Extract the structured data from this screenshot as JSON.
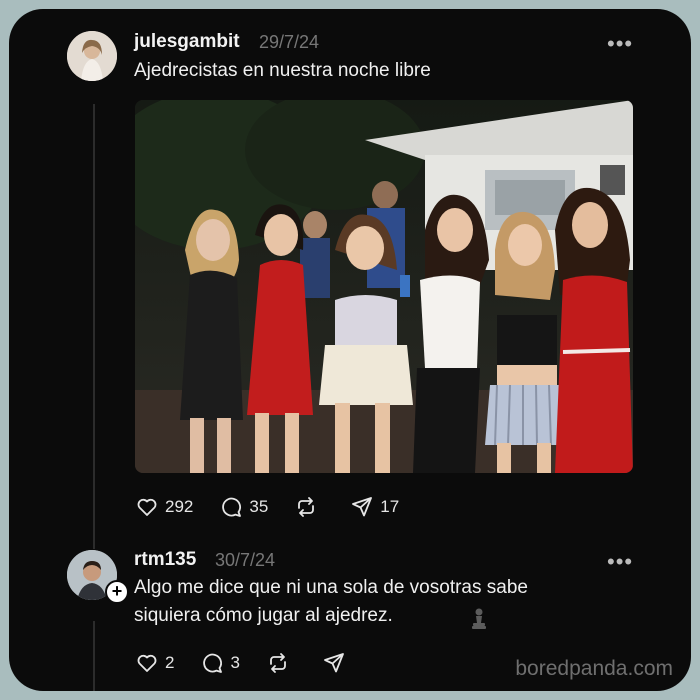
{
  "post": {
    "username": "julesgambit",
    "date": "29/7/24",
    "text": "Ajedrecistas en nuestra noche libre",
    "likes": "292",
    "comments": "35",
    "shares": "17"
  },
  "reply": {
    "username": "rtm135",
    "date": "30/7/24",
    "text_line1": "Algo me dice que ni una sola de vosotras sabe",
    "text_line2": "siquiera cómo jugar al ajedrez.",
    "likes": "2",
    "comments": "3"
  },
  "more_glyph": "•••",
  "watermark": "boredpanda.com",
  "icons": [
    "heart-icon",
    "comment-icon",
    "repost-icon",
    "send-icon",
    "more-icon",
    "chess-pawn-icon",
    "follow-plus-icon"
  ]
}
